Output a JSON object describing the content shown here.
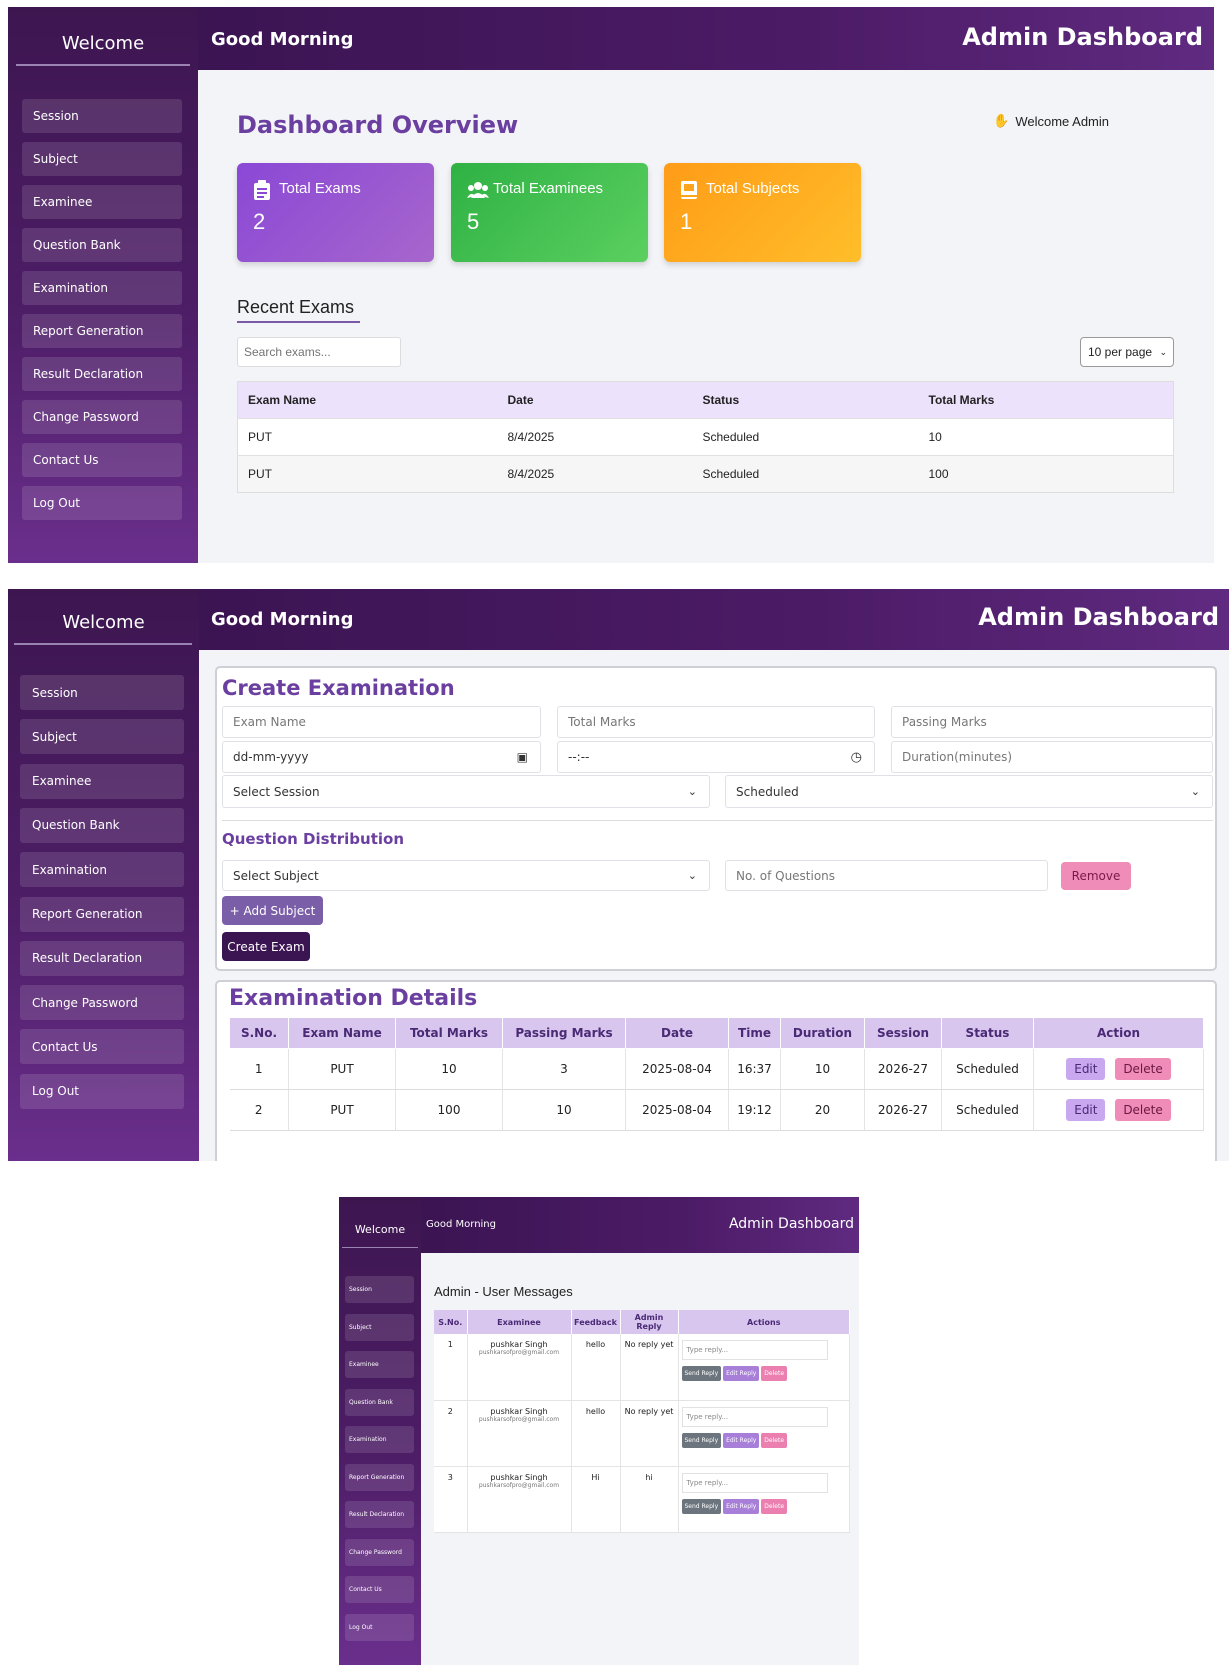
{
  "colors": {
    "sidebar": "#4d1d66",
    "accent_purple": "#6b3fa0",
    "card_exams": "#8b4fd0",
    "card_examinees": "#3dbb4a",
    "card_subjects": "#ffa51c",
    "edit_button": "#c9a8f0",
    "delete_button": "#f08cb8",
    "create_button": "#3b1452"
  },
  "panel1": {
    "sidebar": {
      "welcome": "Welcome",
      "items": [
        "Session",
        "Subject",
        "Examinee",
        "Question Bank",
        "Examination",
        "Report Generation",
        "Result Declaration",
        "Change Password",
        "Contact Us",
        "Log Out"
      ]
    },
    "topbar": {
      "greeting": "Good Morning",
      "title": "Admin Dashboard"
    },
    "overview_title": "Dashboard Overview",
    "welcome_admin": "Welcome Admin",
    "cards": [
      {
        "label": "Total Exams",
        "value": "2",
        "icon": "clipboard-icon"
      },
      {
        "label": "Total Examinees",
        "value": "5",
        "icon": "users-icon"
      },
      {
        "label": "Total Subjects",
        "value": "1",
        "icon": "book-icon"
      }
    ],
    "recent_title": "Recent Exams",
    "search_placeholder": "Search exams...",
    "per_page": "10 per page",
    "table": {
      "headers": [
        "Exam Name",
        "Date",
        "Status",
        "Total Marks"
      ],
      "rows": [
        [
          "PUT",
          "8/4/2025",
          "Scheduled",
          "10"
        ],
        [
          "PUT",
          "8/4/2025",
          "Scheduled",
          "100"
        ]
      ]
    }
  },
  "panel2": {
    "sidebar": {
      "welcome": "Welcome",
      "items": [
        "Session",
        "Subject",
        "Examinee",
        "Question Bank",
        "Examination",
        "Report Generation",
        "Result Declaration",
        "Change Password",
        "Contact Us",
        "Log Out"
      ]
    },
    "topbar": {
      "greeting": "Good Morning",
      "title": "Admin Dashboard"
    },
    "create_title": "Create Examination",
    "fields": {
      "exam_name": "Exam Name",
      "total_marks": "Total Marks",
      "passing_marks": "Passing Marks",
      "date": "dd-mm-yyyy",
      "time": "--:--",
      "duration": "Duration(minutes)",
      "session": "Select Session",
      "status": "Scheduled"
    },
    "distribution_title": "Question Distribution",
    "select_subject": "Select Subject",
    "no_of_questions": "No. of Questions",
    "remove": "Remove",
    "add_subject": "+ Add Subject",
    "create_exam": "Create Exam",
    "details_title": "Examination Details",
    "table": {
      "headers": [
        "S.No.",
        "Exam Name",
        "Total Marks",
        "Passing Marks",
        "Date",
        "Time",
        "Duration",
        "Session",
        "Status",
        "Action"
      ],
      "rows": [
        [
          "1",
          "PUT",
          "10",
          "3",
          "2025-08-04",
          "16:37",
          "10",
          "2026-27",
          "Scheduled"
        ],
        [
          "2",
          "PUT",
          "100",
          "10",
          "2025-08-04",
          "19:12",
          "20",
          "2026-27",
          "Scheduled"
        ]
      ],
      "edit": "Edit",
      "delete": "Delete"
    }
  },
  "panel3": {
    "sidebar": {
      "welcome": "Welcome",
      "items": [
        "Session",
        "Subject",
        "Examinee",
        "Question Bank",
        "Examination",
        "Report Generation",
        "Result Declaration",
        "Change Password",
        "Contact Us",
        "Log Out"
      ]
    },
    "topbar": {
      "greeting": "Good Morning",
      "title": "Admin Dashboard"
    },
    "messages_title": "Admin - User Messages",
    "table": {
      "headers": [
        "S.No.",
        "Examinee",
        "Feedback",
        "Admin Reply",
        "Actions"
      ],
      "rows": [
        {
          "sno": "1",
          "name": "pushkar Singh",
          "email": "pushkarsofpro@gmail.com",
          "feedback": "hello",
          "reply": "No reply yet"
        },
        {
          "sno": "2",
          "name": "pushkar Singh",
          "email": "pushkarsofpro@gmail.com",
          "feedback": "hello",
          "reply": "No reply yet"
        },
        {
          "sno": "3",
          "name": "pushkar Singh",
          "email": "pushkarsofpro@gmail.com",
          "feedback": "Hi",
          "reply": "hi"
        }
      ],
      "reply_placeholder": "Type reply...",
      "send_reply": "Send Reply",
      "edit_reply": "Edit Reply",
      "delete": "Delete"
    }
  }
}
